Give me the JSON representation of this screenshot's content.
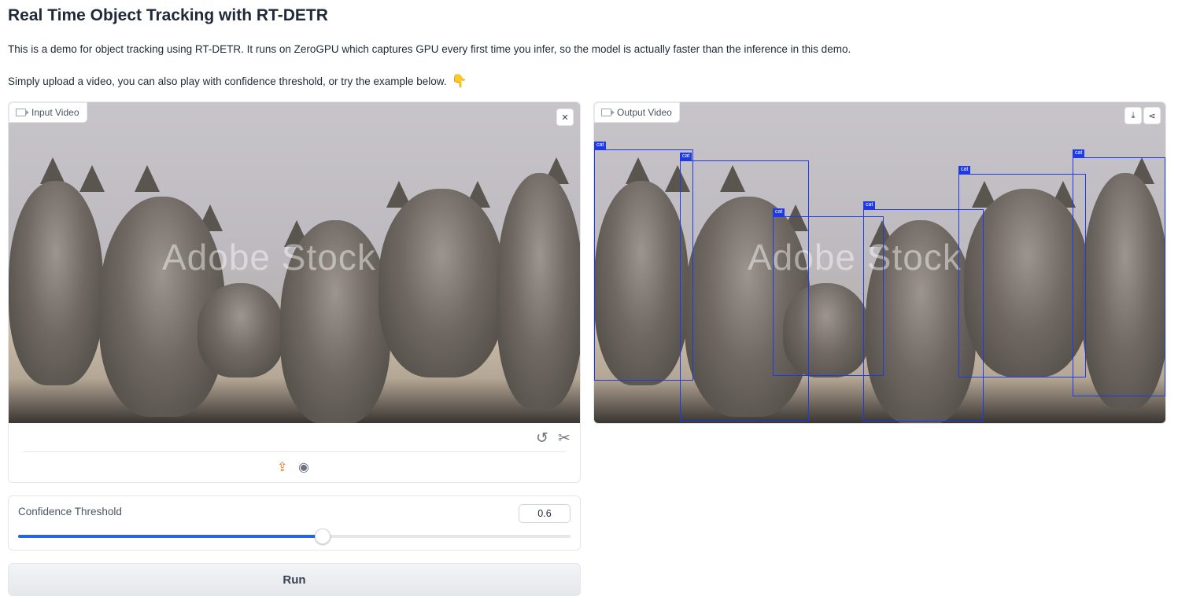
{
  "header": {
    "title": "Real Time Object Tracking with RT-DETR",
    "description": "This is a demo for object tracking using RT-DETR. It runs on ZeroGPU which captures GPU every first time you infer, so the model is actually faster than the inference in this demo.",
    "instruction": "Simply upload a video, you can also play with confidence threshold, or try the example below.",
    "instruction_emoji": "👇"
  },
  "input_video": {
    "label": "Input Video",
    "watermark": "Adobe Stock",
    "icons": [
      "video-camera-icon",
      "close-icon",
      "undo-icon",
      "scissors-icon",
      "upload-icon",
      "webcam-icon"
    ]
  },
  "output_video": {
    "label": "Output Video",
    "watermark": "Adobe Stock",
    "icons": [
      "download-icon",
      "share-icon"
    ],
    "detections": [
      "cat",
      "cat",
      "cat",
      "cat",
      "cat",
      "cat"
    ],
    "box_color": "#1d3ae6"
  },
  "slider": {
    "label": "Confidence Threshold",
    "value": "0.6",
    "level": 0.55,
    "accent": "#2563eb"
  },
  "run_button": {
    "label": "Run"
  }
}
